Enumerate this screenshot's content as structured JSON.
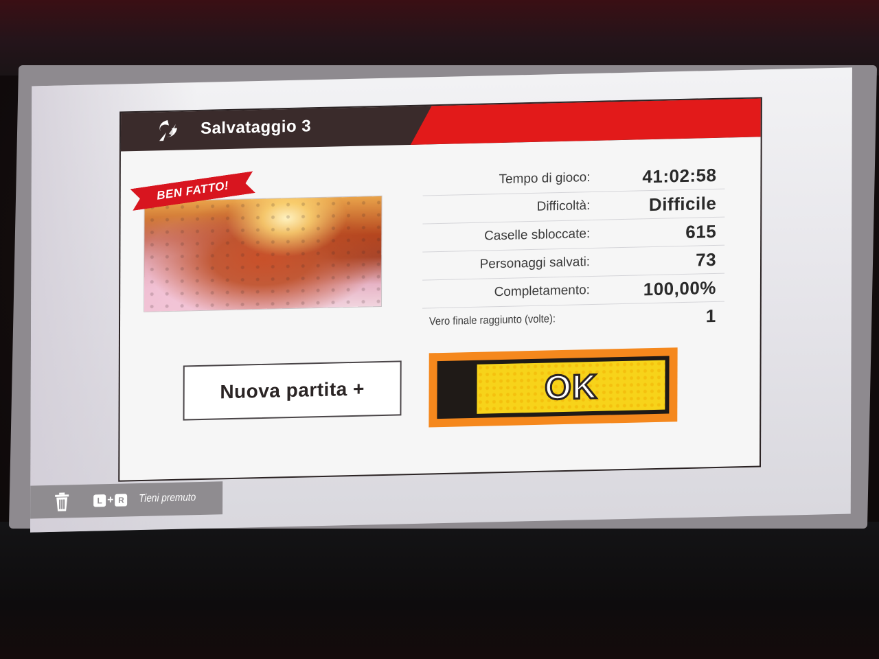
{
  "header": {
    "title": "Salvataggio 3",
    "logo_icon": "smash-ball-swirl-icon"
  },
  "badge": {
    "ribbon_text": "BEN FATTO!"
  },
  "stats": [
    {
      "label": "Tempo di gioco:",
      "value": "41:02:58"
    },
    {
      "label": "Difficoltà:",
      "value": "Difficile"
    },
    {
      "label": "Caselle sbloccate:",
      "value": "615"
    },
    {
      "label": "Personaggi salvati:",
      "value": "73"
    },
    {
      "label": "Completamento:",
      "value": "100,00%"
    },
    {
      "label": "Vero finale raggiunto (volte):",
      "value": "1"
    }
  ],
  "buttons": {
    "new_game": "Nuova partita +",
    "ok": "OK"
  },
  "footer": {
    "key_left": "L",
    "key_plus": "+",
    "key_right": "R",
    "hold_text": "Tieni premuto",
    "delete_icon": "trash-icon"
  },
  "colors": {
    "header_dark": "#3a2b2b",
    "header_red": "#e21a1a",
    "ok_yellow": "#f7d31a",
    "ok_orange": "#f5881d"
  }
}
